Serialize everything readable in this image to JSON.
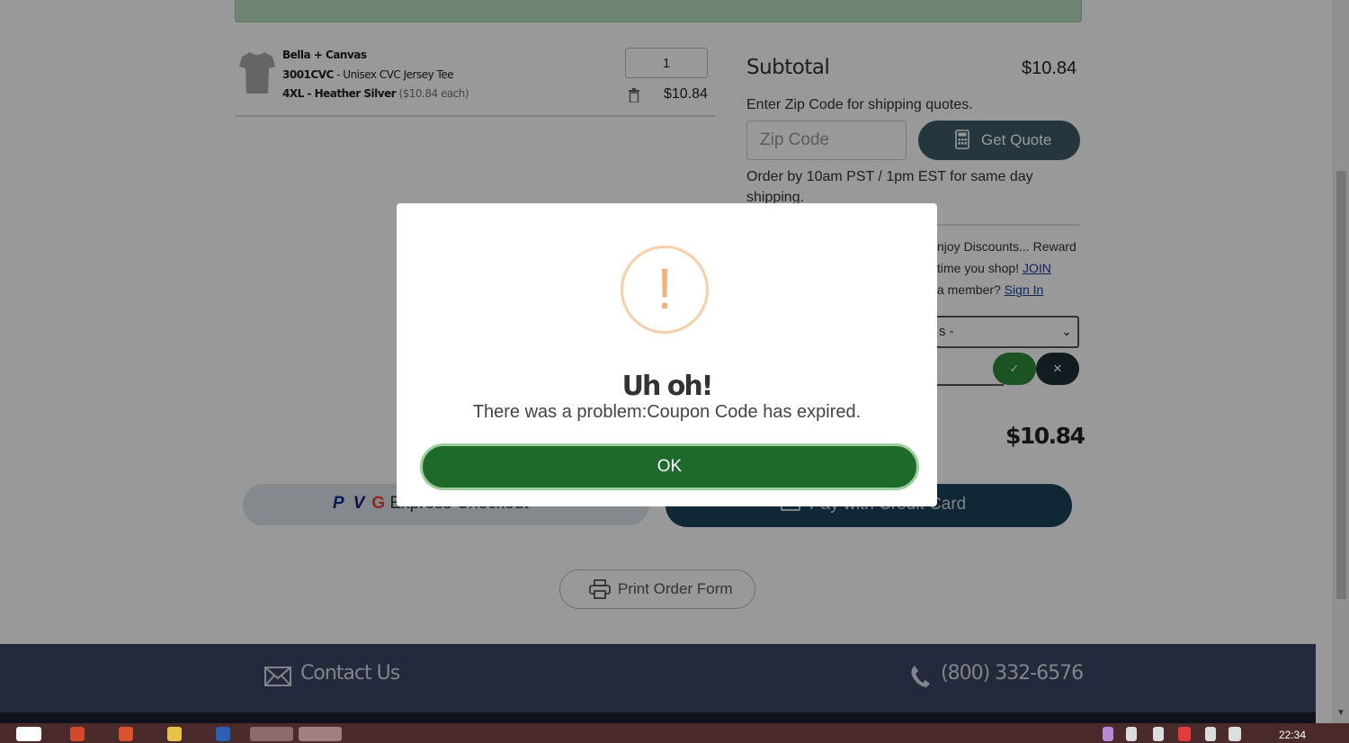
{
  "product": {
    "brand": "Bella + Canvas",
    "sku": "3001CVC",
    "sku_sep": " - ",
    "name": "Unisex CVC Jersey Tee",
    "variant": "4XL - Heather Silver",
    "unit_price": "($10.84 each)",
    "quantity": "1",
    "line_total": "$10.84"
  },
  "summary": {
    "subtotal_label": "Subtotal",
    "subtotal_value": "$10.84",
    "zip_hint": "Enter Zip Code for shipping quotes.",
    "zip_placeholder": "Zip Code",
    "quote_button": "Get Quote",
    "order_note": "Order by 10am PST / 1pm EST for same day shipping.",
    "reward_line1": "njoy Discounts... Reward",
    "reward_line2_prefix": "time you shop! ",
    "reward_join": "JOIN",
    "reward_line3_prefix": "a member? ",
    "reward_signin": "Sign In",
    "select_partial": "s -",
    "total_value": "$10.84"
  },
  "checkout": {
    "express_icons": [
      "P",
      "V",
      "G"
    ],
    "express_label": "Express Checkout",
    "credit_label": "Pay with Credit Card"
  },
  "print_label": "Print Order Form",
  "footer": {
    "contact": "Contact Us",
    "phone": "(800) 332-6576"
  },
  "modal": {
    "icon": "!",
    "title": "Uh oh!",
    "message": "There was a problem:Coupon Code has expired.",
    "ok": "OK"
  },
  "taskbar": {
    "time": "22:34"
  },
  "colors": {
    "modal_ok_bg": "#1e6a2a",
    "quote_btn_bg": "#3e5a6a",
    "footer_bg": "#3a4664",
    "warning": "#f4b27a"
  }
}
